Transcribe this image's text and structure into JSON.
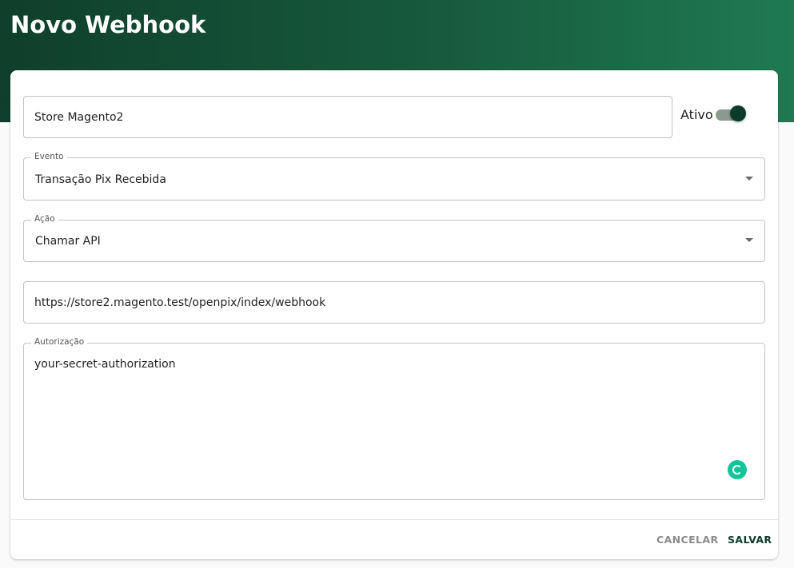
{
  "page": {
    "title": "Novo Webhook"
  },
  "form": {
    "name": {
      "value": "Store Magento2"
    },
    "active": {
      "label": "Ativo",
      "on": true
    },
    "event": {
      "label": "Evento",
      "value": "Transação Pix Recebida"
    },
    "action": {
      "label": "Ação",
      "value": "Chamar API"
    },
    "url": {
      "value": "https://store2.magento.test/openpix/index/webhook"
    },
    "authorization": {
      "label": "Autorização",
      "value": "your-secret-authorization"
    }
  },
  "actions": {
    "cancel_label": "CANCELAR",
    "save_label": "SALVAR"
  },
  "colors": {
    "header_dark": "#0f3f2c",
    "header_light": "#1f7a51",
    "primary": "#0f3b2b",
    "grammar_green": "#15c39a"
  },
  "icons": {
    "select_caret": "chevron-down-icon",
    "textarea_assist": "grammar-assistant-icon"
  }
}
